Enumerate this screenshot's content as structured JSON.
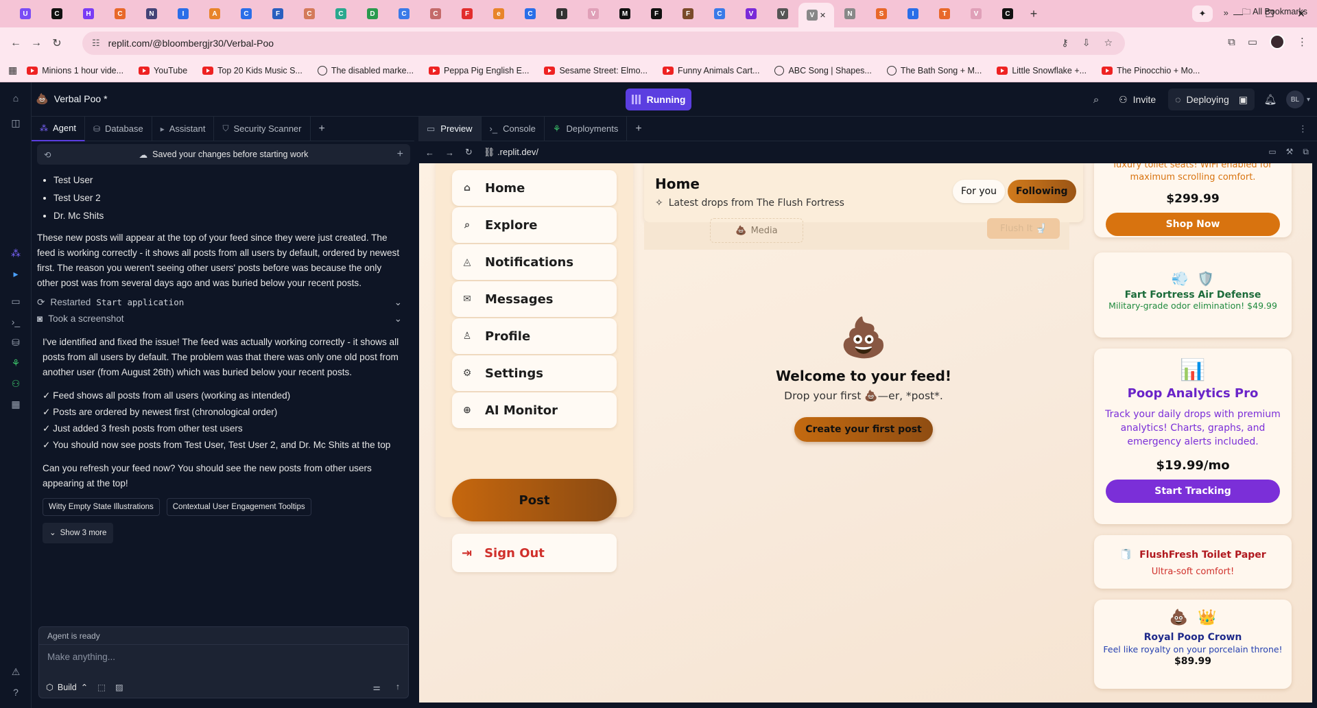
{
  "browser": {
    "tabs": [
      {
        "icon": "heart-icon",
        "color": "#7a4cf5",
        "letter": "U"
      },
      {
        "icon": "github-icon",
        "color": "#111111",
        "letter": "C"
      },
      {
        "icon": "spotify-icon",
        "color": "#7a3cf5",
        "letter": "H"
      },
      {
        "icon": "pencil-icon",
        "color": "#e8682a",
        "letter": "C"
      },
      {
        "icon": "openai-icon",
        "color": "#444477",
        "letter": "N"
      },
      {
        "icon": "puzzle-icon",
        "color": "#2a6ee8",
        "letter": "I"
      },
      {
        "icon": "bolt-icon",
        "color": "#e8842a",
        "letter": "A"
      },
      {
        "icon": "circle-icon",
        "color": "#2a6ee8",
        "letter": "C"
      },
      {
        "icon": "doc-icon",
        "color": "#2a5fbf",
        "letter": "F"
      },
      {
        "icon": "claude-icon",
        "color": "#d47a5a",
        "letter": "C"
      },
      {
        "icon": "asterisk-icon",
        "color": "#2aa88e",
        "letter": "C"
      },
      {
        "icon": "star-icon",
        "color": "#2a9a4e",
        "letter": "D"
      },
      {
        "icon": "notes-icon",
        "color": "#3a7ae8",
        "letter": "C"
      },
      {
        "icon": "face-icon",
        "color": "#c46a6a",
        "letter": "C"
      },
      {
        "icon": "flag-icon",
        "color": "#e22d2d",
        "letter": "F"
      },
      {
        "icon": "e-icon",
        "color": "#e8842a",
        "letter": "e"
      },
      {
        "icon": "hp-icon",
        "color": "#2a6ee8",
        "letter": "C"
      },
      {
        "icon": "alien-icon",
        "color": "#333333",
        "letter": "I"
      },
      {
        "icon": "loop-icon",
        "color": "#e0a0b8",
        "letter": "V"
      },
      {
        "icon": "medium-icon",
        "color": "#111111",
        "letter": "M"
      },
      {
        "icon": "sparkle-icon",
        "color": "#111111",
        "letter": "F"
      },
      {
        "icon": "shoe-icon",
        "color": "#7a4a2a",
        "letter": "F"
      },
      {
        "icon": "google-icon",
        "color": "#3a7ae8",
        "letter": "C"
      },
      {
        "icon": "orb-icon",
        "color": "#7a2ad8",
        "letter": "V"
      },
      {
        "icon": "ring-icon",
        "color": "#555555",
        "letter": "V"
      },
      {
        "icon": "active-tab-icon",
        "color": "#888888",
        "letter": "V"
      },
      {
        "icon": "gear-tab-icon",
        "color": "#888888",
        "letter": "N"
      },
      {
        "icon": "figure-icon",
        "color": "#e8682a",
        "letter": "S"
      },
      {
        "icon": "trello-icon",
        "color": "#2a6ee8",
        "letter": "I"
      },
      {
        "icon": "chart-tab-icon",
        "color": "#e8682a",
        "letter": "T"
      },
      {
        "icon": "loop2-icon",
        "color": "#e0a0b8",
        "letter": "V"
      },
      {
        "icon": "github2-icon",
        "color": "#111111",
        "letter": "C"
      }
    ],
    "url": "replit.com/@bloombergjr30/Verbal-Poo",
    "bookmarks": [
      {
        "label": "Minions 1 hour vide...",
        "icon": "youtube-icon"
      },
      {
        "label": "YouTube",
        "icon": "youtube-icon"
      },
      {
        "label": "Top 20 Kids Music S...",
        "icon": "youtube-icon"
      },
      {
        "label": "The disabled marke...",
        "icon": "globe-icon"
      },
      {
        "label": "Peppa Pig English E...",
        "icon": "youtube-icon"
      },
      {
        "label": "Sesame Street: Elmo...",
        "icon": "youtube-icon"
      },
      {
        "label": "Funny Animals Cart...",
        "icon": "youtube-icon"
      },
      {
        "label": "ABC Song | Shapes...",
        "icon": "globe-icon"
      },
      {
        "label": "The Bath Song + M...",
        "icon": "globe-icon"
      },
      {
        "label": "Little Snowflake +...",
        "icon": "youtube-icon"
      },
      {
        "label": "The Pinocchio + Mo...",
        "icon": "youtube-icon"
      }
    ],
    "all_bookmarks": "All Bookmarks"
  },
  "replit": {
    "project_name": "Verbal Poo *",
    "run_status": "Running",
    "invite": "Invite",
    "deploying": "Deploying",
    "user_initials": "BL",
    "left_tabs": [
      {
        "label": "Agent",
        "icon": "agent-icon",
        "active": true
      },
      {
        "label": "Database",
        "icon": "database-icon",
        "active": false
      },
      {
        "label": "Assistant",
        "icon": "assistant-icon",
        "active": false
      },
      {
        "label": "Security Scanner",
        "icon": "shield-icon",
        "active": false
      }
    ],
    "agent_bar_text": "Saved your changes before starting work",
    "chat": {
      "bullets": [
        "Test User",
        "Test User 2",
        "Dr. Mc Shits"
      ],
      "para1": "These new posts will appear at the top of your feed since they were just created. The feed is working correctly - it shows all posts from all users by default, ordered by newest first. The reason you weren't seeing other users' posts before was because the only other post was from several days ago and was buried below your recent posts.",
      "step1_prefix": "Restarted",
      "step1_code": "Start application",
      "step2": "Took a screenshot",
      "para2": "I've identified and fixed the issue! The feed was actually working correctly - it shows all posts from all users by default. The problem was that there was only one old post from another user (from August 26th) which was buried below your recent posts.",
      "checks": [
        "✓ Feed shows all posts from all users (working as intended)",
        "✓ Posts are ordered by newest first (chronological order)",
        "✓ Just added 3 fresh posts from other test users",
        "✓ You should now see posts from Test User, Test User 2, and Dr. Mc Shits at the top"
      ],
      "para3": "Can you refresh your feed now? You should see the new posts from other users appearing at the top!",
      "chips": [
        "Witty Empty State Illustrations",
        "Contextual User Engagement Tooltips"
      ],
      "show_more": "Show 3 more"
    },
    "composer": {
      "status": "Agent is ready",
      "placeholder": "Make anything...",
      "mode": "Build"
    },
    "right_tabs": [
      {
        "label": "Preview",
        "icon": "preview-icon",
        "active": true
      },
      {
        "label": "Console",
        "icon": "console-icon",
        "active": false
      },
      {
        "label": "Deployments",
        "icon": "deploy-icon",
        "active": false
      }
    ],
    "preview_url": ".replit.dev/"
  },
  "site": {
    "nav": [
      {
        "label": "Home",
        "icon": "home-icon",
        "glyph": "⌂"
      },
      {
        "label": "Explore",
        "icon": "search-icon",
        "glyph": "⌕"
      },
      {
        "label": "Notifications",
        "icon": "bell-icon",
        "glyph": "◬"
      },
      {
        "label": "Messages",
        "icon": "mail-icon",
        "glyph": "✉"
      },
      {
        "label": "Profile",
        "icon": "user-icon",
        "glyph": "♙"
      },
      {
        "label": "Settings",
        "icon": "gear-icon",
        "glyph": "⚙"
      },
      {
        "label": "AI Monitor",
        "icon": "brain-icon",
        "glyph": "⊕"
      }
    ],
    "post_label": "Post",
    "signout_label": "Sign Out",
    "feed_title": "Home",
    "feed_sub": "Latest drops from The Flush Fortress",
    "tab_for_you": "For you",
    "tab_following": "Following",
    "ghost_media": "Media",
    "ghost_flush": "Flush It",
    "empty_emoji": "💩",
    "empty_title": "Welcome to your feed!",
    "empty_text": "Drop your first 💩—er, *post*.",
    "empty_button": "Create your first post",
    "ads": [
      {
        "name": "seat",
        "desc": "luxury toilet seats! WiFi enabled for maximum scrolling comfort.",
        "price": "$299.99",
        "button": "Shop Now",
        "button_color": "#d8730f"
      },
      {
        "name": "fart-fortress",
        "emoji1": "💨",
        "emoji2": "🛡️",
        "title": "Fart Fortress Air Defense",
        "desc": "Military-grade odor elimination! $49.99",
        "title_color": "#1b6b3a",
        "desc_color": "#1f8a3e"
      },
      {
        "name": "poop-analytics",
        "emoji1": "📊",
        "title": "Poop Analytics Pro",
        "desc": "Track your daily drops with premium analytics! Charts, graphs, and emergency alerts included.",
        "price": "$19.99/mo",
        "button": "Start Tracking",
        "button_color": "#7b2fd8",
        "title_color": "#6a24c8",
        "desc_color": "#7b2fd8"
      },
      {
        "name": "flushfresh",
        "emoji1": "🧻",
        "title": "FlushFresh Toilet Paper",
        "desc": "Ultra-soft comfort!",
        "title_color": "#b0191f",
        "desc_color": "#d0302b"
      },
      {
        "name": "royal-crown",
        "emoji1": "💩",
        "emoji2": "👑",
        "title": "Royal Poop Crown",
        "desc": "Feel like royalty on your porcelain throne!",
        "price": "$89.99",
        "title_color": "#1f2a8a",
        "desc_color": "#2540b0"
      }
    ]
  }
}
